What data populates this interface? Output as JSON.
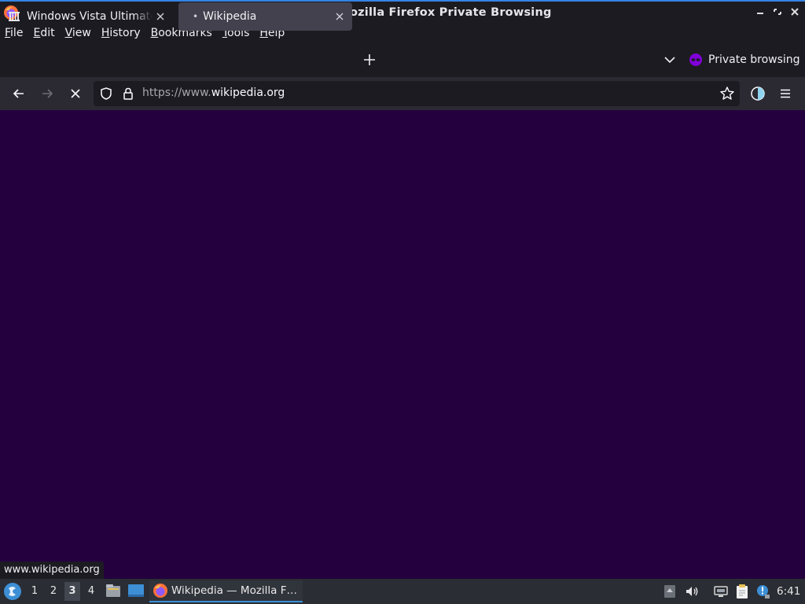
{
  "window": {
    "title": "Wikipedia — Mozilla Firefox Private Browsing",
    "minimize_icon": "minimize-icon",
    "maximize_icon": "maximize-icon",
    "close_icon": "close-icon"
  },
  "menu": {
    "items": [
      {
        "label": "File",
        "underline": "F",
        "rest": "ile"
      },
      {
        "label": "Edit",
        "underline": "E",
        "rest": "dit"
      },
      {
        "label": "View",
        "underline": "V",
        "rest": "iew"
      },
      {
        "label": "History",
        "underline": "H",
        "rest": "istory"
      },
      {
        "label": "Bookmarks",
        "underline": "B",
        "rest": "ookmarks"
      },
      {
        "label": "Tools",
        "underline": "T",
        "rest": "ools"
      },
      {
        "label": "Help",
        "underline": "H",
        "rest": "elp"
      }
    ]
  },
  "tabs": [
    {
      "label": "Windows Vista Ultimate — Wikipedia",
      "icon": "wikipedia-icon",
      "active": false
    },
    {
      "label": "Wikipedia",
      "icon": "loading-dot",
      "active": true
    }
  ],
  "tabbar": {
    "new_tab_icon": "plus-icon",
    "list_all_tabs_icon": "chevron-down-icon",
    "private_label": "Private browsing"
  },
  "navbar": {
    "url_prefix": "https://www.",
    "url_host": "wikipedia.org",
    "back_icon": "arrow-left-icon",
    "forward_icon": "arrow-right-icon",
    "stop_icon": "stop-icon"
  },
  "status": {
    "link_preview": "www.wikipedia.org"
  },
  "taskbar": {
    "workspaces": [
      "1",
      "2",
      "3",
      "4"
    ],
    "active_workspace": "3",
    "task_label": "Wikipedia — Mozilla F…",
    "clock": "6:41"
  },
  "colors": {
    "content_bg": "#25003e",
    "chrome_dark": "#1c1b22",
    "navbar_bg": "#2b2a33",
    "active_tab": "#42414d",
    "taskbar_bg": "#2a2d33",
    "accent": "#3584e4",
    "private_purple": "#8000d7"
  }
}
